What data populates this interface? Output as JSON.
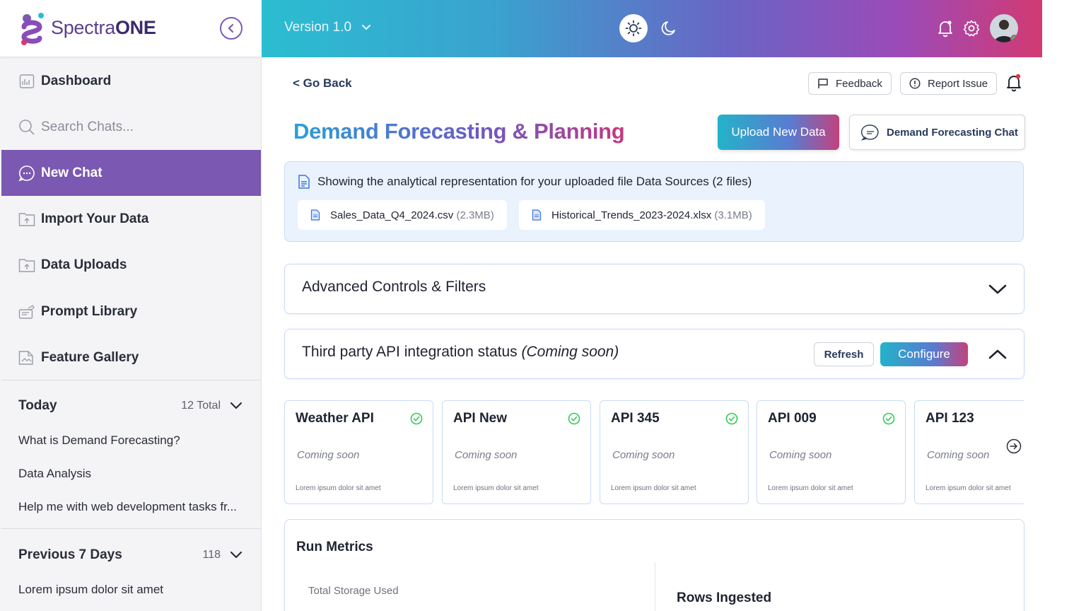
{
  "brand": {
    "name_light": "Spectra",
    "name_bold": "ONE"
  },
  "sidebar": {
    "items": [
      {
        "label": "Dashboard",
        "icon": "dashboard-icon"
      },
      {
        "label": "Search Chats...",
        "icon": "search-icon"
      },
      {
        "label": "New Chat",
        "icon": "chat-bubble-icon",
        "active": true
      },
      {
        "label": "Import Your Data",
        "icon": "folder-upload-icon"
      },
      {
        "label": "Data Uploads",
        "icon": "folder-upload-icon"
      },
      {
        "label": "Prompt Library",
        "icon": "prompt-library-icon"
      },
      {
        "label": "Feature Gallery",
        "icon": "gallery-icon"
      }
    ],
    "today": {
      "title": "Today",
      "count": "12 Total",
      "chats": [
        "What is Demand Forecasting?",
        "Data Analysis",
        "Help me with web development tasks fr..."
      ]
    },
    "previous": {
      "title": "Previous 7 Days",
      "count": "118",
      "chats": [
        "Lorem ipsum dolor sit amet"
      ]
    }
  },
  "header": {
    "version": "Version 1.0"
  },
  "main": {
    "go_back": "< Go Back",
    "feedback_label": "Feedback",
    "report_label": "Report Issue",
    "title": "Demand Forecasting & Planning",
    "upload_label": "Upload New Data",
    "chat_label": "Demand Forecasting Chat",
    "sources": {
      "heading": "Showing the analytical representation for your uploaded file Data Sources (2 files)",
      "files": [
        {
          "name": "Sales_Data_Q4_2024.csv",
          "size": "(2.3MB)"
        },
        {
          "name": "Historical_Trends_2023-2024.xlsx",
          "size": "(3.1MB)"
        }
      ]
    },
    "advanced": {
      "title": "Advanced Controls & Filters"
    },
    "api_status": {
      "title": "Third party API integration status",
      "title_note": "(Coming soon)",
      "refresh_label": "Refresh",
      "configure_label": "Configure"
    },
    "api_cards": [
      {
        "name": "Weather API",
        "status": "Coming soon",
        "desc": "Lorem ipsum dolor sit amet"
      },
      {
        "name": "API New",
        "status": "Coming soon",
        "desc": "Lorem ipsum dolor sit amet"
      },
      {
        "name": "API 345",
        "status": "Coming soon",
        "desc": "Lorem ipsum dolor sit amet"
      },
      {
        "name": "API 009",
        "status": "Coming soon",
        "desc": "Lorem ipsum dolor sit amet"
      },
      {
        "name": "API 123",
        "status": "Coming soon",
        "desc": "Lorem ipsum dolor sit amet"
      }
    ],
    "metrics": {
      "title": "Run Metrics",
      "storage_label": "Total Storage Used",
      "rows_label": "Rows Ingested"
    }
  },
  "colors": {
    "accent_purple": "#7b58b2",
    "status_green": "#2ecc55",
    "border_blue": "#c9dcf5"
  }
}
